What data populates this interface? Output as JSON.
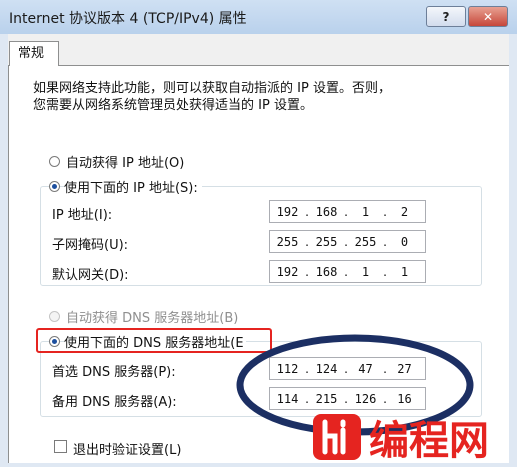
{
  "window": {
    "title": "Internet 协议版本 4 (TCP/IPv4) 属性",
    "help_glyph": "?",
    "close_glyph": "✕"
  },
  "tab": {
    "label": "常规"
  },
  "description": {
    "line1": "如果网络支持此功能，则可以获取自动指派的 IP 设置。否则，",
    "line2": "您需要从网络系统管理员处获得适当的 IP 设置。"
  },
  "ip_section": {
    "auto_option": {
      "label": "自动获得 IP 地址(O)",
      "selected": false
    },
    "manual_option": {
      "label": "使用下面的 IP 地址(S):",
      "selected": true
    },
    "fields": [
      {
        "label": "IP 地址(I):",
        "value": [
          "192",
          "168",
          "1",
          "2"
        ]
      },
      {
        "label": "子网掩码(U):",
        "value": [
          "255",
          "255",
          "255",
          "0"
        ]
      },
      {
        "label": "默认网关(D):",
        "value": [
          "192",
          "168",
          "1",
          "1"
        ]
      }
    ]
  },
  "dns_section": {
    "auto_option": {
      "label": "自动获得 DNS 服务器地址(B)",
      "selected": false,
      "enabled": false
    },
    "manual_option": {
      "label": "使用下面的 DNS 服务器地址(E",
      "selected": true
    },
    "fields": [
      {
        "label": "首选 DNS 服务器(P):",
        "value": [
          "112",
          "124",
          "47",
          "27"
        ]
      },
      {
        "label": "备用 DNS 服务器(A):",
        "value": [
          "114",
          "215",
          "126",
          "16"
        ]
      }
    ]
  },
  "validate_checkbox": {
    "label": "退出时验证设置(L)",
    "checked": false
  },
  "colors": {
    "highlight_box": "#e52420",
    "annotation_ellipse": "#1c2f63",
    "watermark": "#e52420"
  },
  "watermark": {
    "text": "编程网"
  }
}
